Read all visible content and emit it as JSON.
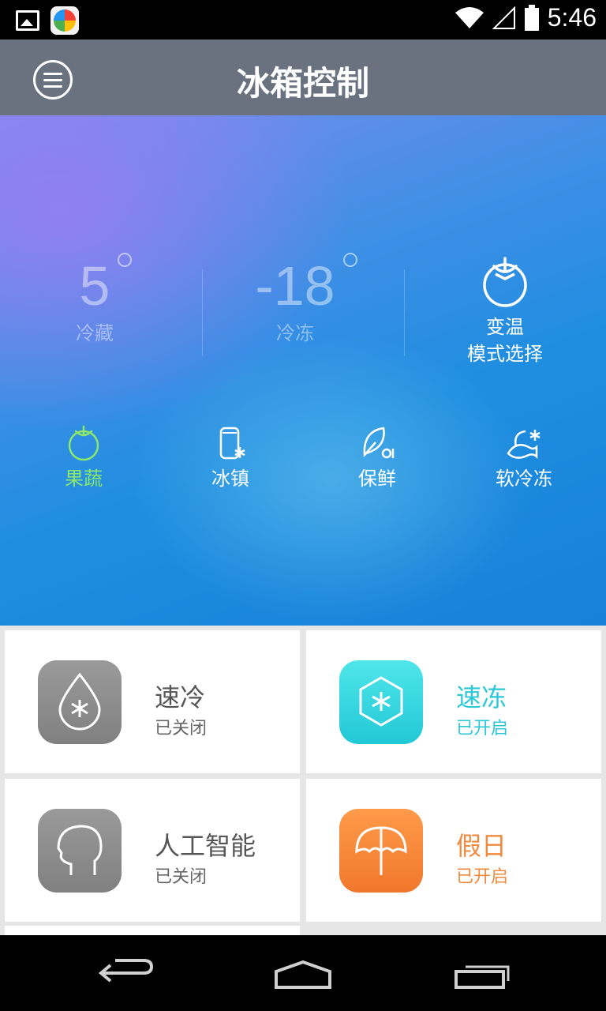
{
  "status_bar": {
    "time": "5:46",
    "icons": [
      "gallery-icon",
      "app-icon",
      "wifi-icon",
      "signal-icon",
      "battery-icon"
    ]
  },
  "app_bar": {
    "title": "冰箱控制",
    "menu_icon": "menu-icon"
  },
  "hero": {
    "fridge": {
      "value": "5",
      "label": "冷藏"
    },
    "freezer": {
      "value": "-18",
      "label": "冷冻"
    },
    "mode": {
      "line1": "变温",
      "line2": "模式选择",
      "icon": "tomato-icon"
    },
    "functions": [
      {
        "label": "果蔬",
        "icon": "tomato-icon",
        "active": true
      },
      {
        "label": "冰镇",
        "icon": "can-snow-icon",
        "active": false
      },
      {
        "label": "保鲜",
        "icon": "leaf-icon",
        "active": false
      },
      {
        "label": "软冷冻",
        "icon": "fish-icon",
        "active": false
      }
    ],
    "colors": {
      "active": "#8be86a",
      "inactive": "#ffffff"
    }
  },
  "cards": [
    {
      "title": "速冷",
      "status": "已关闭",
      "icon": "drop-snow-icon",
      "color": "#8c8c8c",
      "text_color": "#555555",
      "status_color": "#666666"
    },
    {
      "title": "速冻",
      "status": "已开启",
      "icon": "hexagon-snow-icon",
      "color": "#2fd6dc",
      "text_color": "#2cc8d8",
      "status_color": "#2cc8d8"
    },
    {
      "title": "人工智能",
      "status": "已关闭",
      "icon": "head-icon",
      "color": "#8c8c8c",
      "text_color": "#555555",
      "status_color": "#666666"
    },
    {
      "title": "假日",
      "status": "已开启",
      "icon": "umbrella-icon",
      "color": "#f5863a",
      "text_color": "#f08a3e",
      "status_color": "#f08a3e"
    }
  ],
  "nav": [
    "back-icon",
    "home-icon",
    "recents-icon"
  ]
}
